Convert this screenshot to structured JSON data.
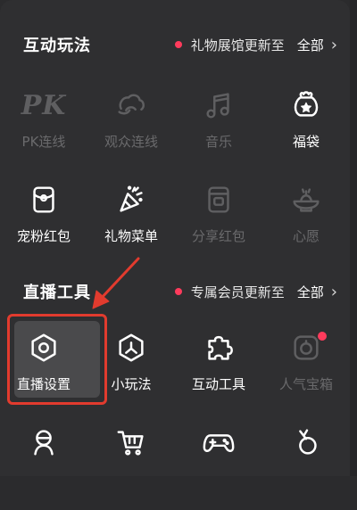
{
  "section1": {
    "title": "互动玩法",
    "notice": "礼物展馆更新至",
    "all_label": "全部",
    "items": [
      {
        "label": "PK连线",
        "icon": "pk-icon",
        "enabled": false
      },
      {
        "label": "观众连线",
        "icon": "audience-link-icon",
        "enabled": false
      },
      {
        "label": "音乐",
        "icon": "music-note-icon",
        "enabled": false
      },
      {
        "label": "福袋",
        "icon": "lucky-bag-icon",
        "enabled": true
      },
      {
        "label": "宠粉红包",
        "icon": "red-packet-icon",
        "enabled": true
      },
      {
        "label": "礼物菜单",
        "icon": "party-popper-icon",
        "enabled": true
      },
      {
        "label": "分享红包",
        "icon": "share-red-packet-icon",
        "enabled": false
      },
      {
        "label": "心愿",
        "icon": "wish-lamp-icon",
        "enabled": false
      }
    ]
  },
  "section2": {
    "title": "直播工具",
    "notice": "专属会员更新至",
    "all_label": "全部",
    "items": [
      {
        "label": "直播设置",
        "icon": "hexagon-settings-icon",
        "enabled": true,
        "highlighted": true
      },
      {
        "label": "小玩法",
        "icon": "mini-game-icon",
        "enabled": true
      },
      {
        "label": "互动工具",
        "icon": "puzzle-icon",
        "enabled": true
      },
      {
        "label": "人气宝箱",
        "icon": "popularity-box-icon",
        "enabled": false,
        "badge": true
      },
      {
        "label": "",
        "icon": "avatar-icon",
        "enabled": true
      },
      {
        "label": "",
        "icon": "shopping-cart-icon",
        "enabled": true
      },
      {
        "label": "",
        "icon": "gamepad-icon",
        "enabled": true
      },
      {
        "label": "",
        "icon": "vine-icon",
        "enabled": true
      }
    ]
  },
  "colors": {
    "background": "#2f2f31",
    "accent_dot": "#ff3b5c",
    "highlight_border": "#e23b2e",
    "disabled_text": "#6a6a6c"
  }
}
